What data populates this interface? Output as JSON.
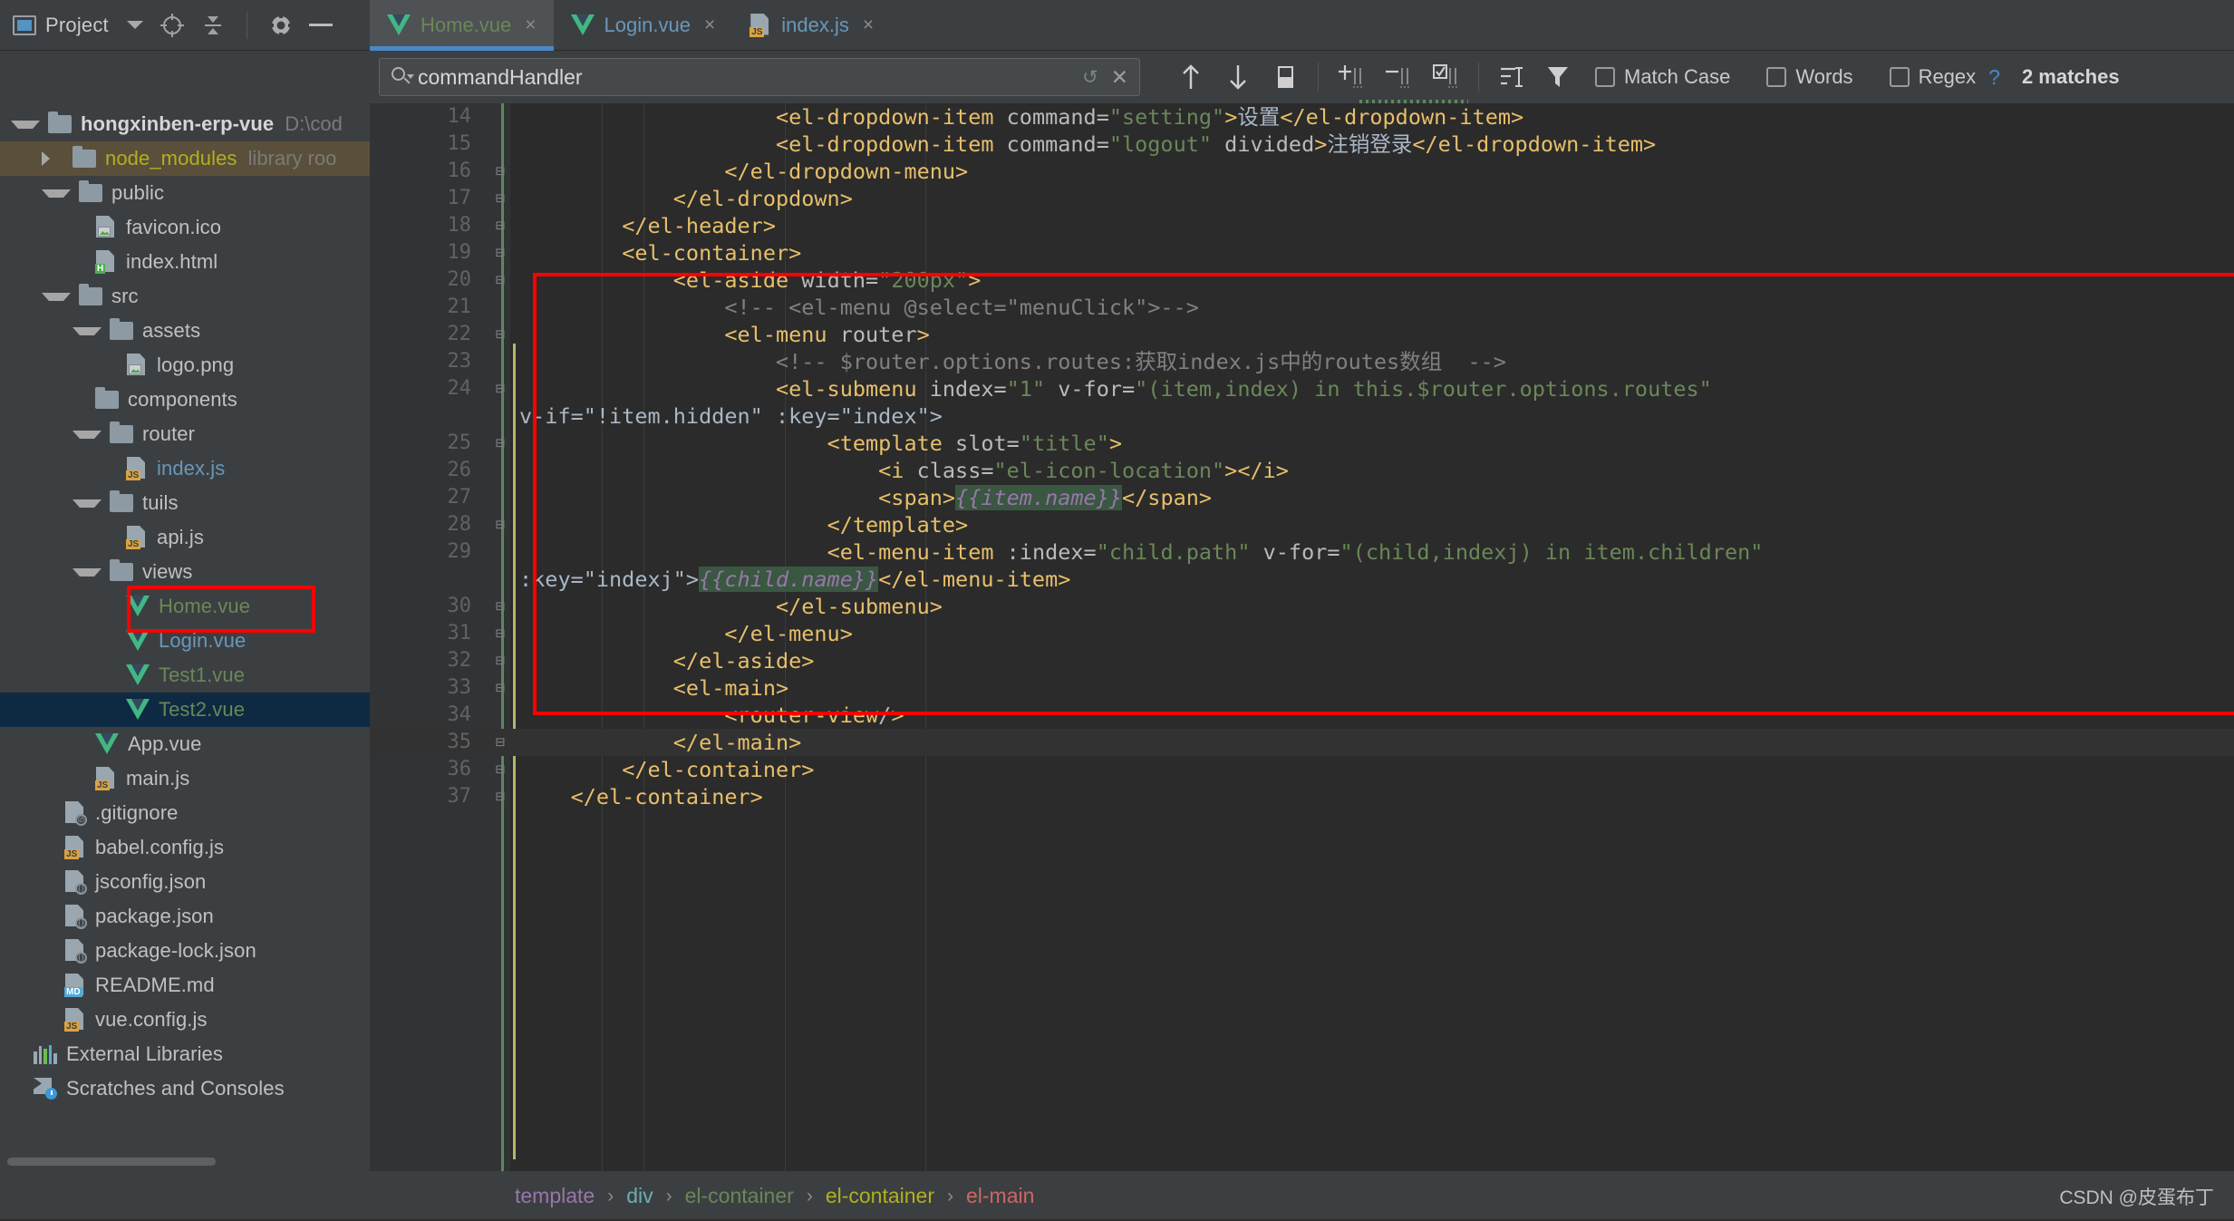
{
  "project_toolbar": {
    "label": "Project",
    "icons": [
      "project-window-icon",
      "locate-icon",
      "collapse-all-icon",
      "settings-gear-icon",
      "hide-icon"
    ]
  },
  "tabs": [
    {
      "label": "Home.vue",
      "icon": "vue-file-icon",
      "active": true,
      "close": "×"
    },
    {
      "label": "Login.vue",
      "icon": "vue-file-icon",
      "active": false,
      "close": "×"
    },
    {
      "label": "index.js",
      "icon": "js-file-icon",
      "active": false,
      "close": "×"
    }
  ],
  "search": {
    "value": "commandHandler",
    "placeholder": "commandHandler",
    "refresh_icon": "↺",
    "close_icon": "✕"
  },
  "find_toolbar": {
    "buttons": [
      "find-previous-icon",
      "find-next-icon",
      "select-all-occurrences-icon",
      "add-line-icon",
      "remove-line-icon",
      "select-all-lines-icon",
      "filter-lines-icon",
      "filter-icon"
    ],
    "checkboxes": [
      {
        "label": "Match Case",
        "checked": false,
        "mnemonic": "C"
      },
      {
        "label": "Words",
        "checked": false,
        "mnemonic": "o"
      },
      {
        "label": "Regex",
        "checked": false,
        "mnemonic": "x"
      }
    ],
    "help_icon": "?",
    "match_count": "2 matches"
  },
  "tree": [
    {
      "indent": 0,
      "arrow": "down",
      "icon": "folder-icon",
      "label": "hongxinben-erp-vue",
      "style": "bold",
      "suffix": "D:\\cod"
    },
    {
      "indent": 1,
      "arrow": "right",
      "icon": "folder-icon",
      "label": "node_modules",
      "style": "yellow",
      "suffix": "library roo",
      "highlight": "brown"
    },
    {
      "indent": 1,
      "arrow": "down",
      "icon": "folder-icon",
      "label": "public",
      "style": ""
    },
    {
      "indent": 2,
      "arrow": "none",
      "icon": "image-file-icon",
      "label": "favicon.ico",
      "style": ""
    },
    {
      "indent": 2,
      "arrow": "none",
      "icon": "html-file-icon",
      "label": "index.html",
      "style": "",
      "badge": "H"
    },
    {
      "indent": 1,
      "arrow": "down",
      "icon": "folder-icon",
      "label": "src",
      "style": ""
    },
    {
      "indent": 2,
      "arrow": "down",
      "icon": "folder-icon",
      "label": "assets",
      "style": ""
    },
    {
      "indent": 3,
      "arrow": "none",
      "icon": "image-file-icon",
      "label": "logo.png",
      "style": ""
    },
    {
      "indent": 2,
      "arrow": "none",
      "icon": "folder-icon",
      "label": "components",
      "style": ""
    },
    {
      "indent": 2,
      "arrow": "down",
      "icon": "folder-icon",
      "label": "router",
      "style": ""
    },
    {
      "indent": 3,
      "arrow": "none",
      "icon": "js-file-icon",
      "label": "index.js",
      "style": "blue",
      "badge": "JS"
    },
    {
      "indent": 2,
      "arrow": "down",
      "icon": "folder-icon",
      "label": "tuils",
      "style": ""
    },
    {
      "indent": 3,
      "arrow": "none",
      "icon": "js-file-icon",
      "label": "api.js",
      "style": "",
      "badge": "JS"
    },
    {
      "indent": 2,
      "arrow": "down",
      "icon": "folder-icon",
      "label": "views",
      "style": ""
    },
    {
      "indent": 3,
      "arrow": "none",
      "icon": "vue-file-icon",
      "label": "Home.vue",
      "style": "green",
      "boxed": true
    },
    {
      "indent": 3,
      "arrow": "none",
      "icon": "vue-file-icon",
      "label": "Login.vue",
      "style": "blue"
    },
    {
      "indent": 3,
      "arrow": "none",
      "icon": "vue-file-icon",
      "label": "Test1.vue",
      "style": "green"
    },
    {
      "indent": 3,
      "arrow": "none",
      "icon": "vue-file-icon",
      "label": "Test2.vue",
      "style": "green",
      "highlight": "blue"
    },
    {
      "indent": 2,
      "arrow": "none",
      "icon": "vue-file-icon",
      "label": "App.vue",
      "style": ""
    },
    {
      "indent": 2,
      "arrow": "none",
      "icon": "js-file-icon",
      "label": "main.js",
      "style": "",
      "badge": "JS"
    },
    {
      "indent": 1,
      "arrow": "none",
      "icon": "ignored-file-icon",
      "label": ".gitignore",
      "style": ""
    },
    {
      "indent": 1,
      "arrow": "none",
      "icon": "js-file-icon",
      "label": "babel.config.js",
      "style": "",
      "badge": "JS"
    },
    {
      "indent": 1,
      "arrow": "none",
      "icon": "json-file-icon",
      "label": "jsconfig.json",
      "style": ""
    },
    {
      "indent": 1,
      "arrow": "none",
      "icon": "json-file-icon",
      "label": "package.json",
      "style": ""
    },
    {
      "indent": 1,
      "arrow": "none",
      "icon": "json-file-icon",
      "label": "package-lock.json",
      "style": ""
    },
    {
      "indent": 1,
      "arrow": "none",
      "icon": "md-file-icon",
      "label": "README.md",
      "style": "",
      "badge": "MD"
    },
    {
      "indent": 1,
      "arrow": "none",
      "icon": "js-file-icon",
      "label": "vue.config.js",
      "style": "",
      "badge": "JS"
    },
    {
      "indent": 0,
      "arrow": "none",
      "icon": "external-libraries-icon",
      "label": "External Libraries",
      "style": ""
    },
    {
      "indent": 0,
      "arrow": "none",
      "icon": "scratches-icon",
      "label": "Scratches and Consoles",
      "style": ""
    }
  ],
  "editor": {
    "first_line_number": 14,
    "lines": [
      {
        "n": "14",
        "fold": "",
        "text": "                    <el-dropdown-item command=\"setting\">设置</el-dropdown-item>"
      },
      {
        "n": "15",
        "fold": "",
        "text": "                    <el-dropdown-item command=\"logout\" divided>注销登录</el-dropdown-item>"
      },
      {
        "n": "16",
        "fold": "-",
        "text": "                </el-dropdown-menu>"
      },
      {
        "n": "17",
        "fold": "-",
        "text": "            </el-dropdown>"
      },
      {
        "n": "18",
        "fold": "-",
        "text": "        </el-header>"
      },
      {
        "n": "19",
        "fold": "-",
        "text": "        <el-container>"
      },
      {
        "n": "20",
        "fold": "-",
        "text": "            <el-aside width=\"200px\">"
      },
      {
        "n": "21",
        "fold": "",
        "text": "                <!-- <el-menu @select=\"menuClick\">-->"
      },
      {
        "n": "22",
        "fold": "-",
        "text": "                <el-menu router>"
      },
      {
        "n": "23",
        "fold": "",
        "text": "                    <!-- $router.options.routes:获取index.js中的routes数组  -->"
      },
      {
        "n": "24",
        "fold": "-",
        "text": "                    <el-submenu index=\"1\" v-for=\"(item,index) in this.$router.options.routes\" v-if=\"!item.hidden\" :key=\"index\">"
      },
      {
        "n": "25",
        "fold": "-",
        "text": "                        <template slot=\"title\">"
      },
      {
        "n": "26",
        "fold": "",
        "text": "                            <i class=\"el-icon-location\"></i>"
      },
      {
        "n": "27",
        "fold": "",
        "text": "                            <span>{{item.name}}</span>"
      },
      {
        "n": "28",
        "fold": "-",
        "text": "                        </template>"
      },
      {
        "n": "29",
        "fold": "",
        "text": "                        <el-menu-item :index=\"child.path\" v-for=\"(child,indexj) in item.children\" :key=\"indexj\">{{child.name}}</el-menu-item>"
      },
      {
        "n": "30",
        "fold": "-",
        "text": "                    </el-submenu>"
      },
      {
        "n": "31",
        "fold": "-",
        "text": "                </el-menu>"
      },
      {
        "n": "32",
        "fold": "-",
        "text": "            </el-aside>"
      },
      {
        "n": "33",
        "fold": "-",
        "text": "            <el-main>"
      },
      {
        "n": "34",
        "fold": "",
        "text": "                <router-view/>"
      },
      {
        "n": "35",
        "fold": "-",
        "text": "            </el-main>"
      },
      {
        "n": "36",
        "fold": "-",
        "text": "        </el-container>"
      },
      {
        "n": "37",
        "fold": "-",
        "text": "    </el-container>"
      }
    ],
    "highlighted_matches": [
      "commandHandler"
    ],
    "selection_box_label": "red-annotation-box"
  },
  "browser_popup": {
    "icons": [
      "chrome-icon",
      "firefox-icon",
      "safari-icon",
      "opera-icon",
      "ie-icon",
      "edge-icon"
    ]
  },
  "breadcrumb": [
    {
      "label": "template",
      "color": "#9876aa"
    },
    {
      "label": "div",
      "color": "#6ab0b0"
    },
    {
      "label": "el-container",
      "color": "#6a8759"
    },
    {
      "label": "el-container",
      "color": "#b0b021"
    },
    {
      "label": "el-main",
      "color": "#cc6666"
    }
  ],
  "breadcrumb_separator": "›",
  "watermark": "CSDN @皮蛋布丁"
}
